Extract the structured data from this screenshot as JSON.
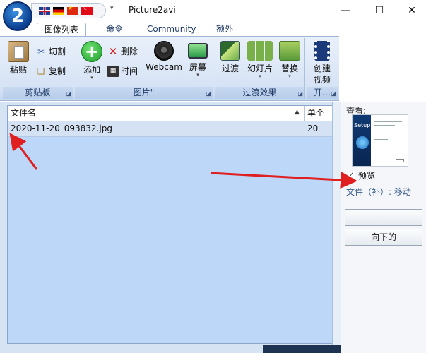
{
  "window": {
    "title": "Picture2avi",
    "logo_text": "2",
    "controls": {
      "minimize": "—",
      "maximize": "☐",
      "close": "✕"
    }
  },
  "quick_access": {
    "flags": [
      "uk-flag-icon",
      "de-flag-icon",
      "cn-flag-icon",
      "tr-flag-icon"
    ],
    "dropdown": "▾"
  },
  "tabs": [
    {
      "label": "图像列表",
      "active": true
    },
    {
      "label": "命令",
      "active": false
    },
    {
      "label": "Community",
      "active": false
    },
    {
      "label": "额外",
      "active": false
    }
  ],
  "ribbon": {
    "clipboard": {
      "label": "剪贴板",
      "paste": "粘贴",
      "cut": "切割",
      "copy": "复制"
    },
    "pictures": {
      "label": "图片\"",
      "add": "添加",
      "delete": "删除",
      "time": "时间",
      "webcam": "Webcam",
      "screen": "屏幕"
    },
    "transitions": {
      "label": "过渡效果",
      "transition": "过渡",
      "slideshow": "幻灯片",
      "replace": "替换"
    },
    "video": {
      "label": "开...",
      "create_line1": "创建",
      "create_line2": "视频"
    }
  },
  "list": {
    "columns": [
      "文件名",
      "单个"
    ],
    "rows": [
      {
        "filename": "2020-11-20_093832.jpg",
        "value": "20"
      }
    ]
  },
  "right_panel": {
    "view_label": "查看:",
    "thumb_text": "Setup",
    "preview_label": "预览",
    "preview_checked": true,
    "file_move_text": "文件（补）: 移动",
    "button_empty": "",
    "button_down": "向下的"
  },
  "colors": {
    "accent": "#1a5fb4",
    "list_bg": "#bcd7f7",
    "arrow": "#e02020"
  }
}
